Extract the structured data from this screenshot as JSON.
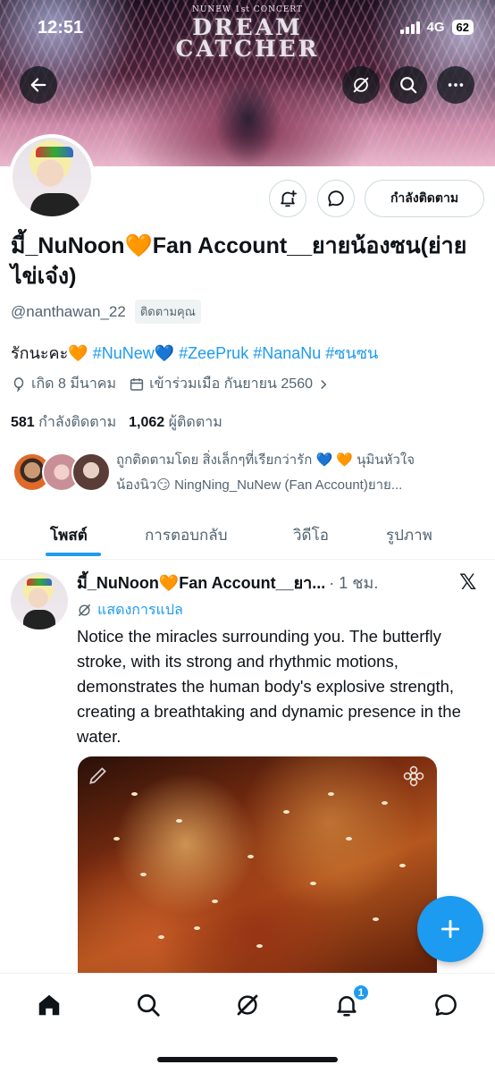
{
  "status_bar": {
    "time": "12:51",
    "network": "4G",
    "battery": "62"
  },
  "banner": {
    "concert_label": "NUNEW 1st CONCERT",
    "title_line1": "DREAM",
    "title_line2": "CATCHER"
  },
  "profile": {
    "display_name": "มี้_NuNoon🧡Fan Account__ยายน้องซน(ย่ายไข่เจ๋ง)",
    "handle": "@nanthawan_22",
    "follows_you": "ติดตามคุณ",
    "bio_text": "รักนะคะ",
    "bio_hashtags": [
      "#NuNew",
      "#ZeePruk",
      "#NanaNu",
      "#ซนซน"
    ],
    "birthday": "เกิด 8 มีนาคม",
    "joined": "เข้าร่วมเมือ กันยายน 2560",
    "following_count": "581",
    "following_label": "กำลังติดตาม",
    "followers_count": "1,062",
    "followers_label": "ผู้ติดตาม",
    "followed_by_line1": "ถูกติดตามโดย สิ่งเล็กๆที่เรียกว่ารัก 💙 🧡 นุมินหัวใจ",
    "followed_by_line2": "น้องนิว😏 NingNing_NuNew (Fan Account)ยาย...",
    "following_button": "กำลังติดตาม"
  },
  "tabs": [
    "โพสต์",
    "การตอบกลับ",
    "วิดีโอ",
    "รูปภาพ"
  ],
  "post": {
    "name": "มี้_NuNoon🧡Fan Account__ยา...",
    "time": "· 1 ชม.",
    "translate": "แสดงการแปล",
    "text": "Notice the miracles surrounding you. The butterfly stroke, with its strong and rhythmic motions, demonstrates the human body's explosive strength, creating a breathtaking and dynamic presence in the water."
  },
  "nav": {
    "notification_badge": "1"
  },
  "icons": [
    "back-arrow-icon",
    "grok-icon",
    "search-icon",
    "more-icon",
    "notification-bell-plus-icon",
    "message-icon",
    "birthday-balloon-icon",
    "calendar-icon",
    "chevron-right-icon",
    "x-logo-icon",
    "translate-icon",
    "edit-pencil-icon",
    "flower-icon",
    "plus-icon",
    "home-icon",
    "bell-icon"
  ],
  "colors": {
    "accent": "#1d9bf0",
    "text": "#0f1419",
    "secondary": "#536471"
  }
}
